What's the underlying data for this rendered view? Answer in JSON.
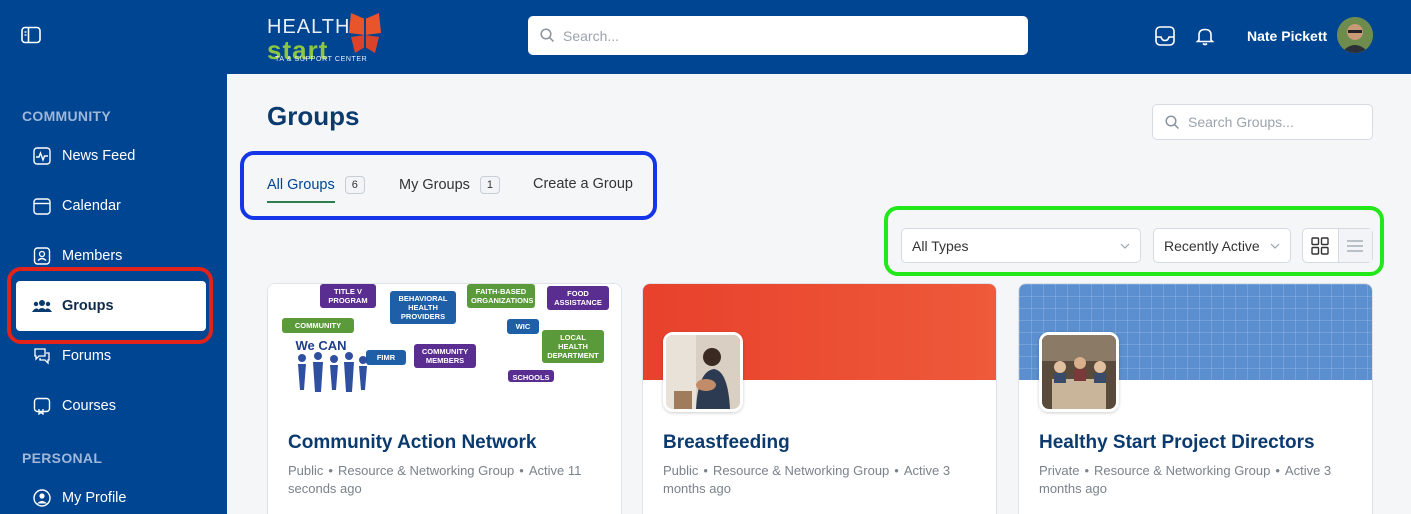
{
  "header": {
    "logo": {
      "line1": "HEALTHY",
      "line2": "start",
      "line3": "TA & SUPPORT CENTER"
    },
    "search_placeholder": "Search...",
    "user_name": "Nate Pickett"
  },
  "sidebar": {
    "sections": [
      {
        "label": "COMMUNITY"
      },
      {
        "label": "PERSONAL"
      }
    ],
    "items": [
      {
        "label": "News Feed",
        "icon": "activity-icon"
      },
      {
        "label": "Calendar",
        "icon": "calendar-icon"
      },
      {
        "label": "Members",
        "icon": "members-icon"
      },
      {
        "label": "Groups",
        "icon": "groups-icon",
        "active": true
      },
      {
        "label": "Forums",
        "icon": "forums-icon"
      },
      {
        "label": "Courses",
        "icon": "courses-icon"
      },
      {
        "label": "My Profile",
        "icon": "profile-icon"
      }
    ]
  },
  "main": {
    "title": "Groups",
    "search_groups_placeholder": "Search Groups...",
    "tabs": [
      {
        "label": "All Groups",
        "count": "6",
        "active": true
      },
      {
        "label": "My Groups",
        "count": "1"
      },
      {
        "label": "Create a Group"
      }
    ],
    "filters": {
      "type_selected": "All Types",
      "sort_selected": "Recently Active"
    },
    "cards": [
      {
        "title": "Community Action Network",
        "visibility": "Public",
        "group_type": "Resource & Networking Group",
        "activity": "Active 11 seconds ago",
        "cover_words": [
          "TITLE V PROGRAM",
          "BEHAVIORAL HEALTH PROVIDERS",
          "FAITH-BASED ORGANIZATIONS",
          "FOOD ASSISTANCE",
          "COMMUNITY",
          "WIC",
          "LOCAL HEALTH DEPARTMENT",
          "We CAN",
          "FIMR",
          "COMMUNITY MEMBERS",
          "SCHOOLS"
        ]
      },
      {
        "title": "Breastfeeding",
        "visibility": "Public",
        "group_type": "Resource & Networking Group",
        "activity": "Active 3 months ago"
      },
      {
        "title": "Healthy Start Project Directors",
        "visibility": "Private",
        "group_type": "Resource & Networking Group",
        "activity": "Active 3 months ago"
      }
    ]
  },
  "colors": {
    "brand_blue": "#004592",
    "highlight_red": "#e2231a",
    "highlight_blue": "#1436e8",
    "highlight_green": "#22e81a"
  }
}
